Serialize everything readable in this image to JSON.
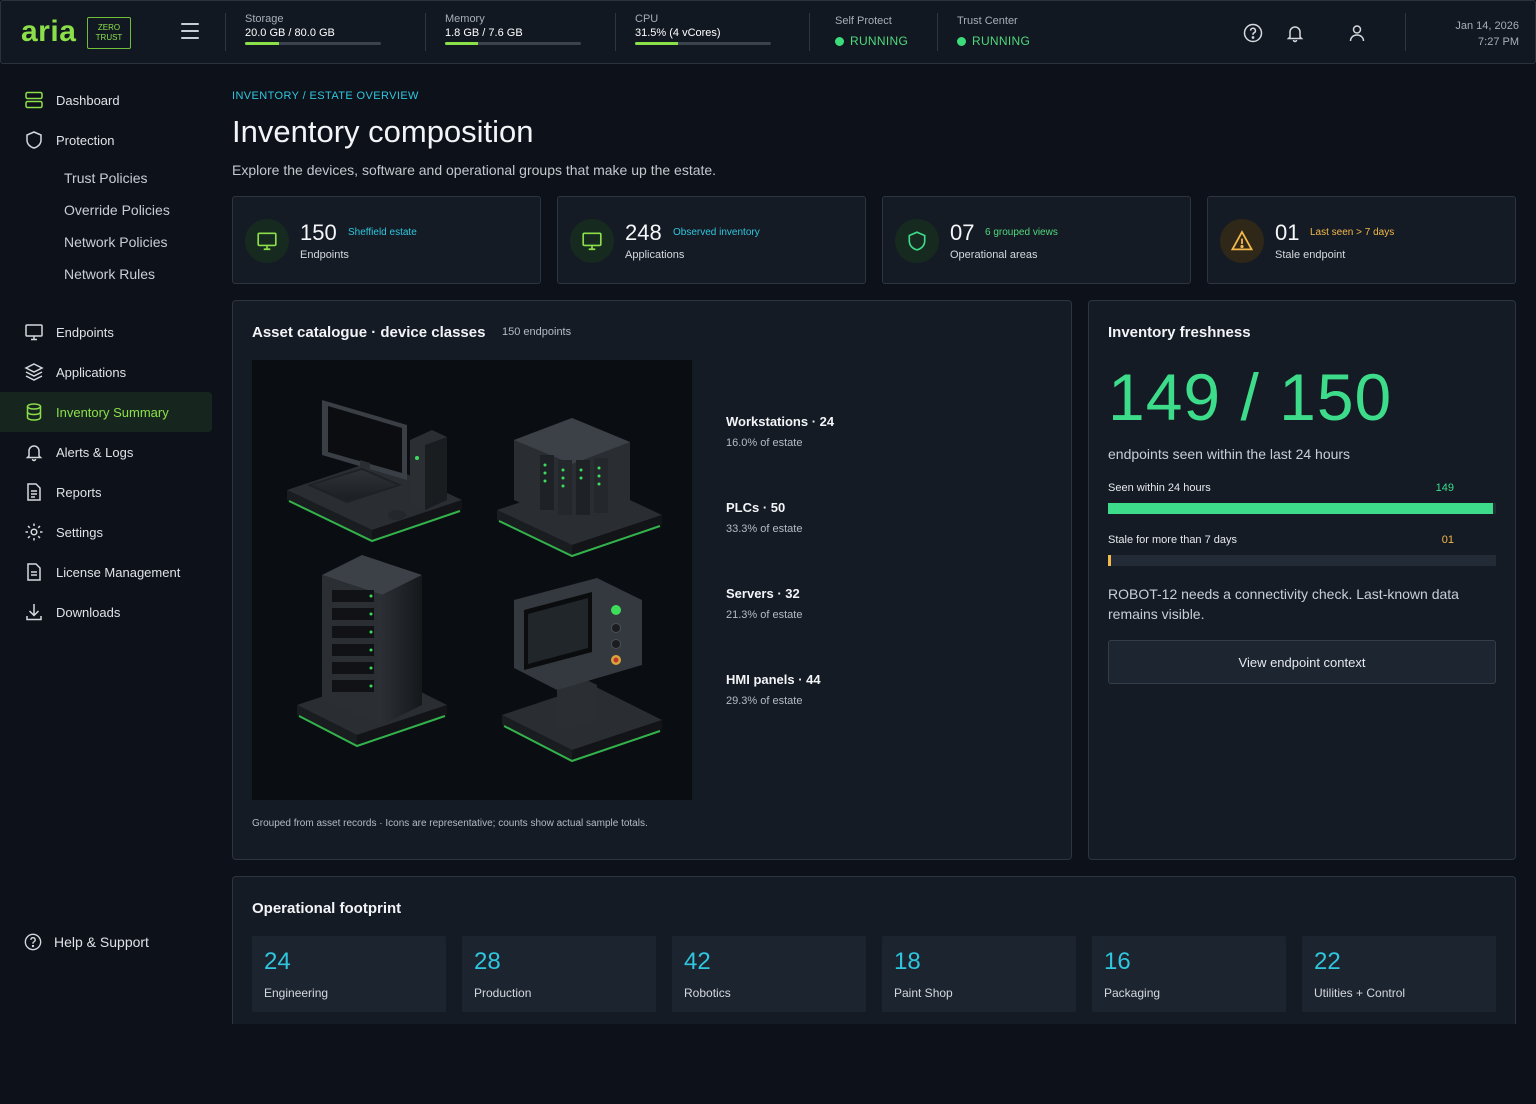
{
  "app": {
    "logo": "aria",
    "badge": "ZERO TRUST"
  },
  "topbar": {
    "metrics": [
      {
        "label": "Storage",
        "value": "20.0 GB / 80.0 GB",
        "fill": 0.25
      },
      {
        "label": "Memory",
        "value": "1.8 GB / 7.6 GB",
        "fill": 0.24
      },
      {
        "label": "CPU",
        "value": "31.5% (4 vCores)",
        "fill": 0.315
      }
    ],
    "services": [
      {
        "label": "Self Protect",
        "status": "RUNNING"
      },
      {
        "label": "Trust Center",
        "status": "RUNNING"
      }
    ],
    "date": "Jan 14, 2026",
    "time": "7:27 PM"
  },
  "sidebar": {
    "items": [
      "Dashboard",
      "Protection",
      "Endpoints",
      "Applications",
      "Inventory Summary",
      "Alerts & Logs",
      "Reports",
      "Settings",
      "License Management",
      "Downloads"
    ],
    "sub_items": [
      "Trust Policies",
      "Override Policies",
      "Network Policies",
      "Network Rules"
    ],
    "help": "Help & Support"
  },
  "header": {
    "breadcrumb": "INVENTORY / ESTATE OVERVIEW",
    "title": "Inventory composition",
    "subtitle": "Explore the devices, software and operational groups that make up the estate."
  },
  "stats": [
    {
      "value": "150",
      "tag": "Sheffield estate",
      "label": "Endpoints",
      "icon": "monitor-icon"
    },
    {
      "value": "248",
      "tag": "Observed inventory",
      "label": "Applications",
      "icon": "monitor-icon"
    },
    {
      "value": "07",
      "tag": "6 grouped views",
      "label": "Operational areas",
      "icon": "shield-icon"
    },
    {
      "value": "01",
      "tag": "Last seen > 7 days",
      "label": "Stale endpoint",
      "icon": "warning-icon"
    }
  ],
  "catalogue": {
    "title": "Asset catalogue · device classes",
    "count": "150 endpoints",
    "classes": [
      {
        "name": "Workstations · 24",
        "pct": "16.0% of estate"
      },
      {
        "name": "PLCs · 50",
        "pct": "33.3% of estate"
      },
      {
        "name": "Servers · 32",
        "pct": "21.3% of estate"
      },
      {
        "name": "HMI panels · 44",
        "pct": "29.3% of estate"
      }
    ],
    "footnote": "Grouped from asset records · Icons are representative; counts show actual sample totals."
  },
  "freshness": {
    "title": "Inventory freshness",
    "ratio": "149 / 150",
    "subtitle": "endpoints seen within the last 24 hours",
    "bars": [
      {
        "label": "Seen within 24 hours",
        "value": "149",
        "fraction": 0.993,
        "color": "#3ddc8a"
      },
      {
        "label": "Stale for more than 7 days",
        "value": "01",
        "fraction": 0.007,
        "color": "#f2b84b"
      }
    ],
    "note": "ROBOT-12 needs a connectivity check. Last-known data remains visible.",
    "button": "View endpoint context"
  },
  "footprint": {
    "title": "Operational footprint",
    "areas": [
      {
        "count": "24",
        "name": "Engineering"
      },
      {
        "count": "28",
        "name": "Production"
      },
      {
        "count": "42",
        "name": "Robotics"
      },
      {
        "count": "18",
        "name": "Paint Shop"
      },
      {
        "count": "16",
        "name": "Packaging"
      },
      {
        "count": "22",
        "name": "Utilities + Control"
      }
    ]
  }
}
